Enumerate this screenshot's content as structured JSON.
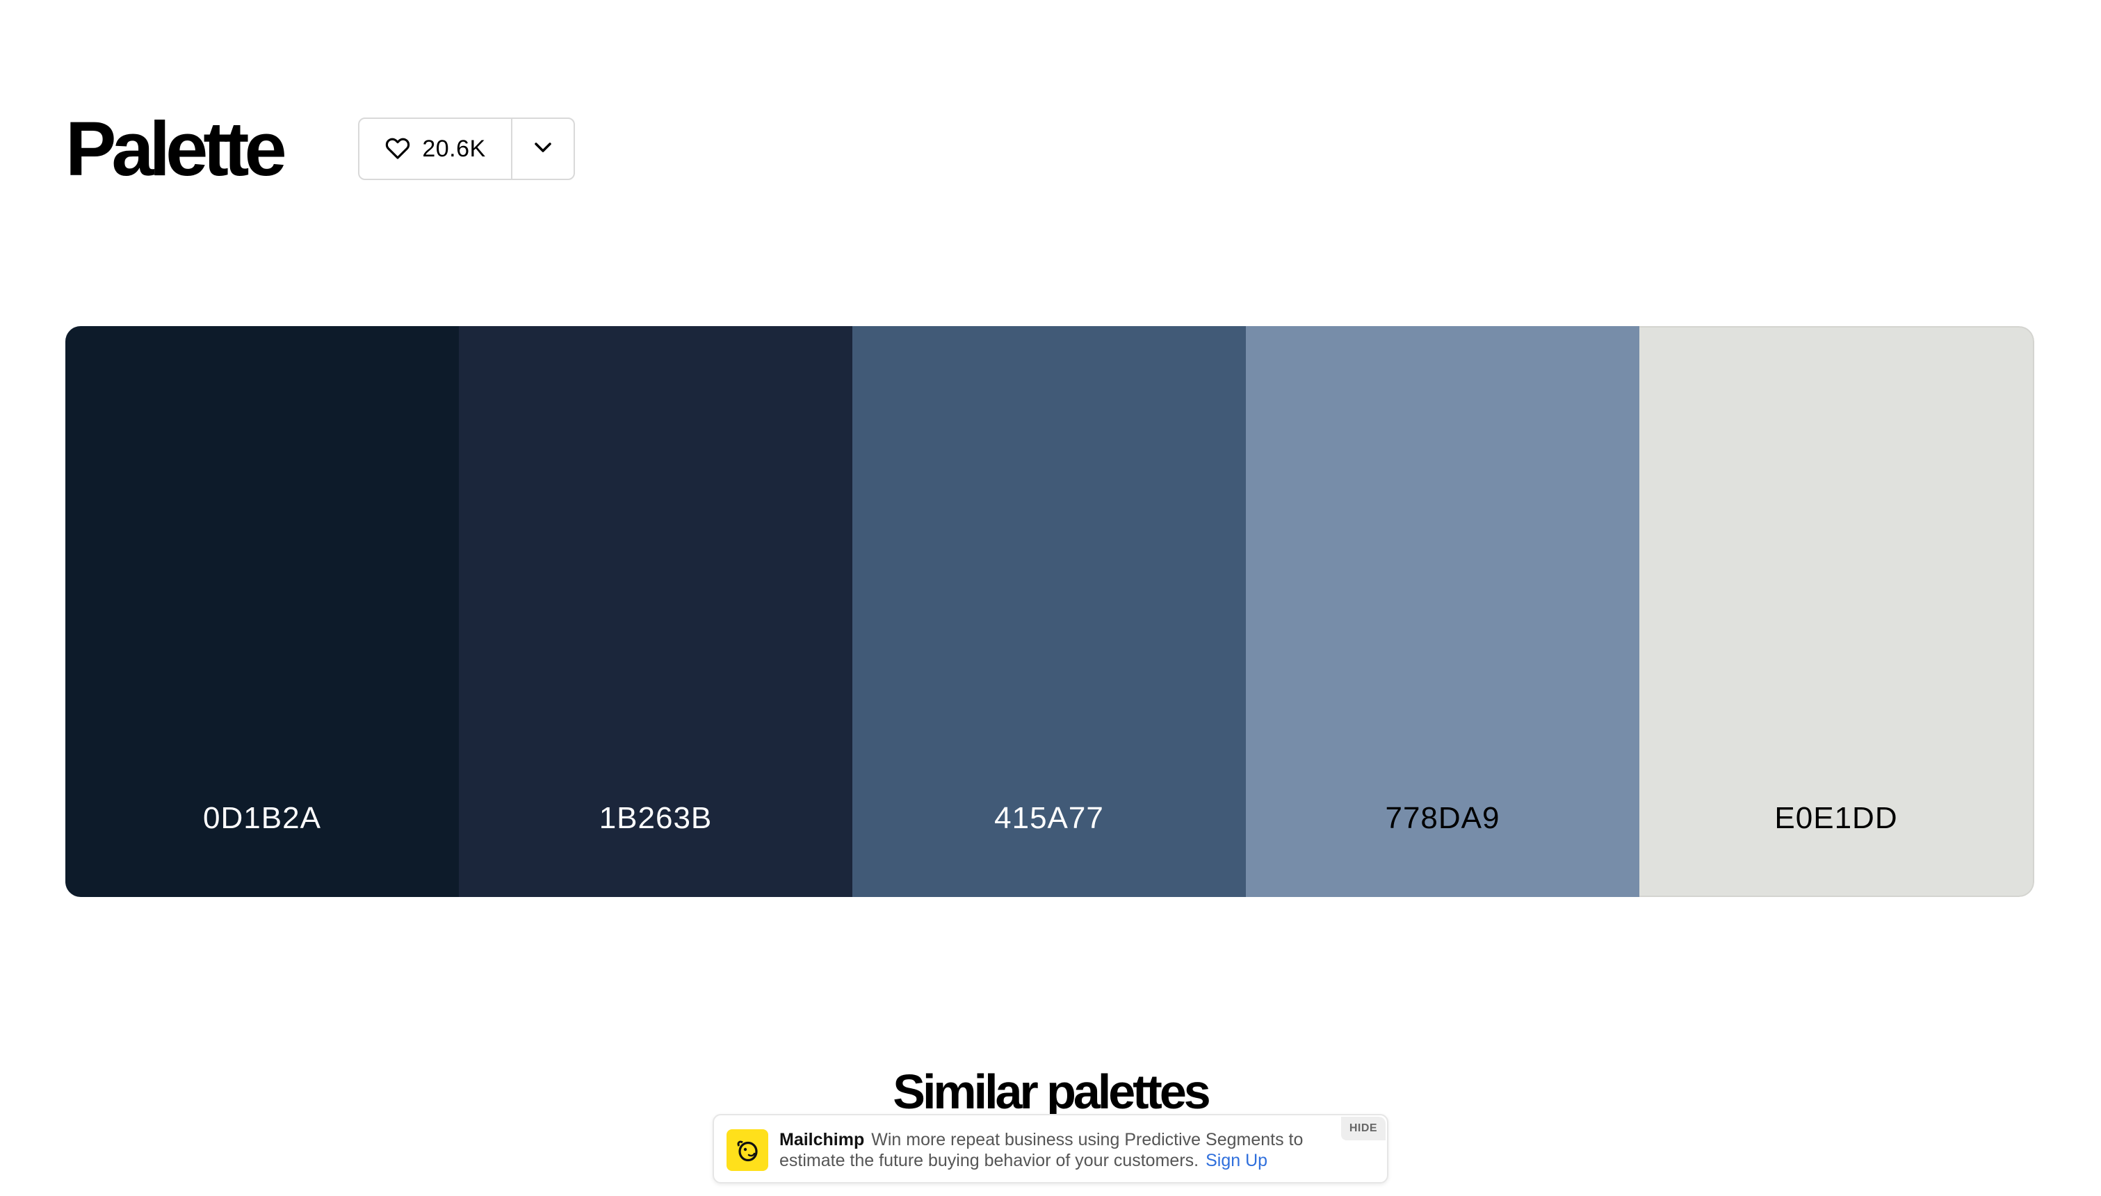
{
  "header": {
    "title": "Palette",
    "likes": "20.6K",
    "like_icon": "heart-icon",
    "more_icon": "chevron-down-icon"
  },
  "palette": {
    "colors": [
      {
        "hex": "0D1B2A",
        "color": "#0d1b2a",
        "text_color": "#ffffff"
      },
      {
        "hex": "1B263B",
        "color": "#1b263b",
        "text_color": "#ffffff"
      },
      {
        "hex": "415A77",
        "color": "#415a77",
        "text_color": "#ffffff"
      },
      {
        "hex": "778DA9",
        "color": "#778da9",
        "text_color": "#000000"
      },
      {
        "hex": "E0E1DD",
        "color": "#e0e1dd",
        "text_color": "#000000"
      }
    ]
  },
  "similar": {
    "title": "Similar palettes"
  },
  "ad": {
    "brand": "Mailchimp",
    "text": "Win more repeat business using Predictive Segments to estimate the future buying behavior of your customers.",
    "link": "Sign Up",
    "hide_label": "HIDE",
    "logo_icon": "mailchimp-logo-icon",
    "accent": "#ffe01b",
    "link_color": "#2f6fdc"
  }
}
